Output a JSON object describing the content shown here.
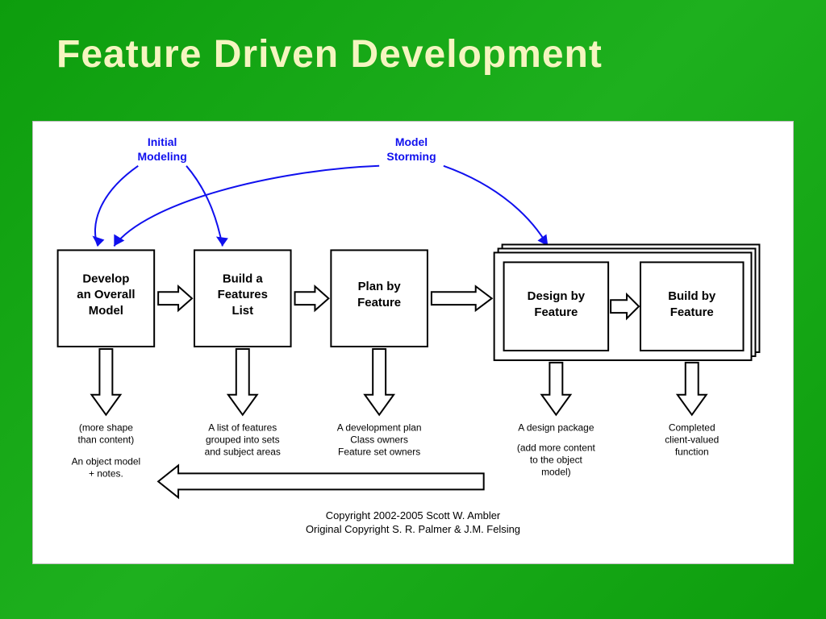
{
  "title": "Feature Driven Development",
  "blue_labels": {
    "initial_modeling": "Initial Modeling",
    "model_storming": "Model Storming"
  },
  "boxes": {
    "b1_l1": "Develop",
    "b1_l2": "an Overall",
    "b1_l3": "Model",
    "b2_l1": "Build a",
    "b2_l2": "Features",
    "b2_l3": "List",
    "b3_l1": "Plan by",
    "b3_l2": "Feature",
    "b4_l1": "Design by",
    "b4_l2": "Feature",
    "b5_l1": "Build by",
    "b5_l2": "Feature"
  },
  "outputs": {
    "o1_l1": "(more shape",
    "o1_l2": "than content)",
    "o1_l3": "An object model",
    "o1_l4": "+ notes.",
    "o2_l1": "A list of features",
    "o2_l2": "grouped into sets",
    "o2_l3": "and subject areas",
    "o3_l1": "A development plan",
    "o3_l2": "Class owners",
    "o3_l3": "Feature set owners",
    "o4_l1": "A design package",
    "o4_l2": "(add more content",
    "o4_l3": "to the object",
    "o4_l4": "model)",
    "o5_l1": "Completed",
    "o5_l2": "client-valued",
    "o5_l3": "function"
  },
  "copyright": {
    "l1": "Copyright 2002-2005 Scott W. Ambler",
    "l2": "Original Copyright S. R. Palmer & J.M. Felsing"
  }
}
